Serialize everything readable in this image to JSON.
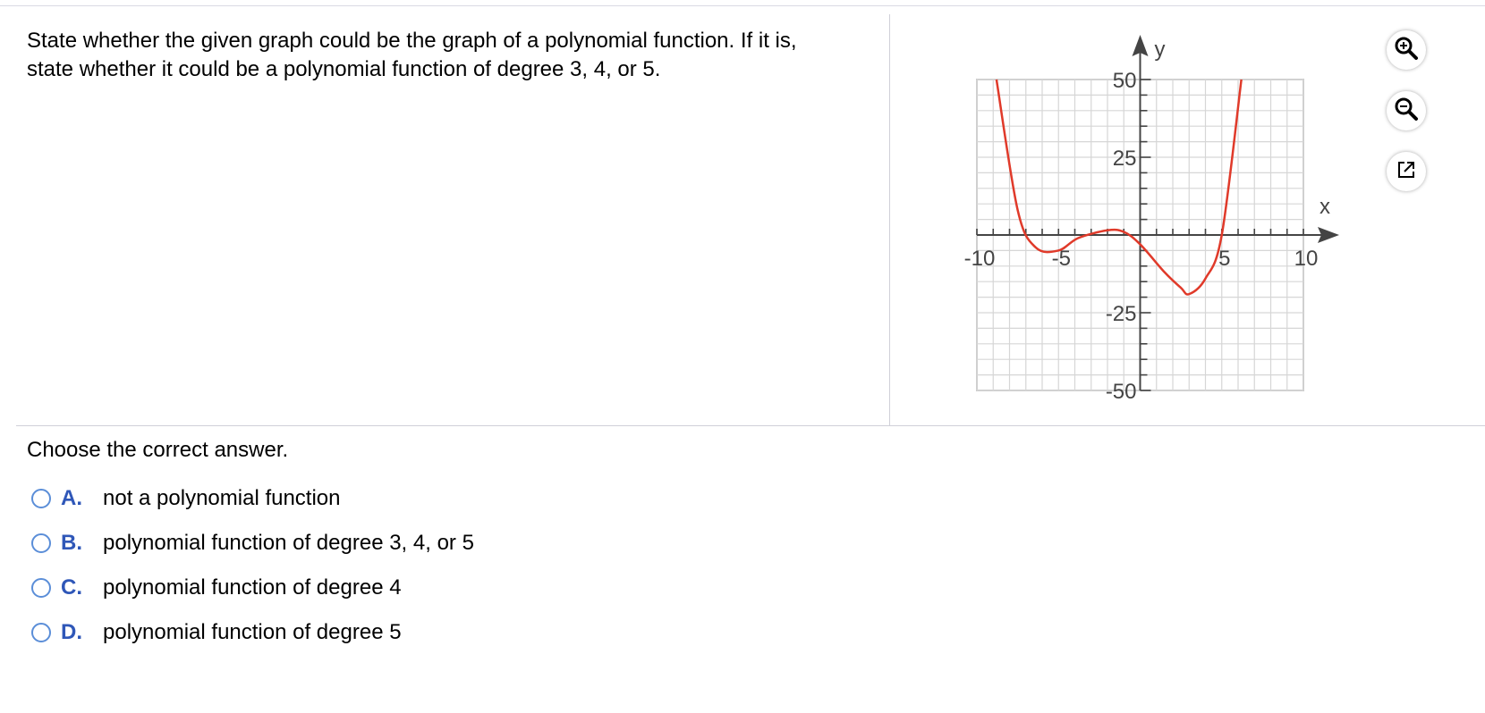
{
  "question": {
    "line1": "State whether the given graph could be the graph of a polynomial function. If it is,",
    "line2": "state whether it could be a polynomial function of degree 3, 4, or 5."
  },
  "answer": {
    "prompt": "Choose the correct answer.",
    "choices": [
      {
        "letter": "A.",
        "text": "not a polynomial function"
      },
      {
        "letter": "B.",
        "text": "polynomial function of degree 3, 4, or 5"
      },
      {
        "letter": "C.",
        "text": "polynomial function of degree 4"
      },
      {
        "letter": "D.",
        "text": "polynomial function of degree 5"
      }
    ]
  },
  "tools": [
    {
      "icon": "zoom-in-icon"
    },
    {
      "icon": "zoom-out-icon"
    },
    {
      "icon": "external-link-icon"
    }
  ],
  "graph": {
    "xlabel": "x",
    "ylabel": "y",
    "xtick_labels": [
      "-10",
      "-5",
      "5",
      "10"
    ],
    "ytick_labels": [
      "50",
      "25",
      "-25",
      "-50"
    ],
    "xrange": [
      -10,
      10
    ],
    "yrange": [
      -50,
      50
    ],
    "curve_color": "#e03a2a"
  },
  "chart_data": {
    "type": "line",
    "title": "",
    "xlabel": "x",
    "ylabel": "y",
    "xlim": [
      -10,
      10
    ],
    "ylim": [
      -50,
      50
    ],
    "grid": true,
    "series": [
      {
        "values_xy": [
          [
            -8.8,
            50
          ],
          [
            -7.5,
            8
          ],
          [
            -6.4,
            -4
          ],
          [
            -5.0,
            -5
          ],
          [
            -3.8,
            -1
          ],
          [
            -2.0,
            1.5
          ],
          [
            -1.0,
            1
          ],
          [
            0,
            -3
          ],
          [
            1.5,
            -12
          ],
          [
            2.5,
            -17
          ],
          [
            3.0,
            -19
          ],
          [
            4.0,
            -14
          ],
          [
            5.0,
            0
          ],
          [
            6.2,
            50
          ]
        ]
      }
    ]
  }
}
